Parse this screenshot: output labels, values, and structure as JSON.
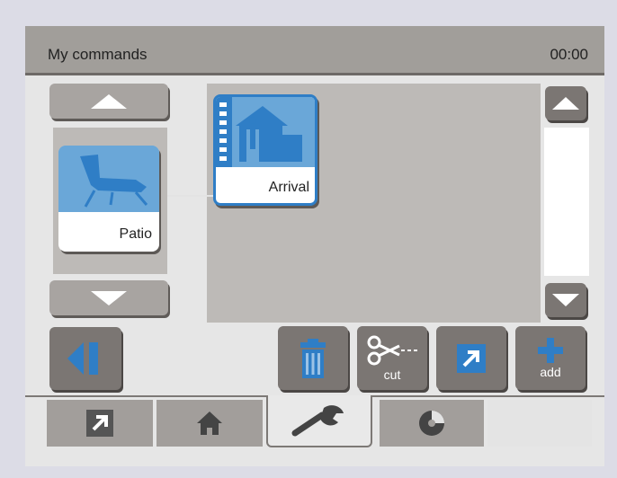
{
  "header": {
    "title": "My commands",
    "clock": "00:00"
  },
  "left_list": {
    "item": {
      "label": "Patio",
      "icon": "lounger-icon"
    }
  },
  "canvas": {
    "item": {
      "label": "Arrival",
      "icon": "house-arrival-icon"
    }
  },
  "toolbar": {
    "cut_label": "cut",
    "add_label": "add"
  },
  "tabs": [
    {
      "icon": "shortcut-arrow-icon"
    },
    {
      "icon": "home-icon"
    },
    {
      "icon": "wrench-icon",
      "active": true
    },
    {
      "icon": "disc-icon"
    },
    {
      "icon": ""
    }
  ],
  "colors": {
    "accent_blue": "#2f7ec6",
    "light_blue": "#6aa7d8",
    "button_grey": "#7b7673"
  }
}
